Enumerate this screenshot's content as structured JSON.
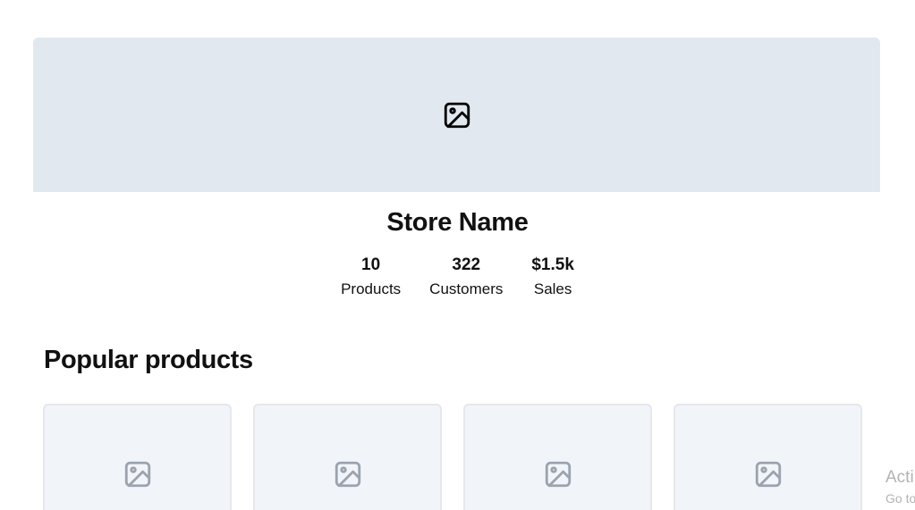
{
  "store": {
    "banner_icon": "image-placeholder-icon",
    "name": "Store Name"
  },
  "stats": [
    {
      "value": "10",
      "label": "Products"
    },
    {
      "value": "322",
      "label": "Customers"
    },
    {
      "value": "$1.5k",
      "label": "Sales"
    }
  ],
  "popular": {
    "title": "Popular products",
    "products": [
      {
        "icon": "image-placeholder-icon"
      },
      {
        "icon": "image-placeholder-icon"
      },
      {
        "icon": "image-placeholder-icon"
      },
      {
        "icon": "image-placeholder-icon"
      }
    ]
  },
  "watermark": {
    "line1": "Acti",
    "line2": "Go to"
  },
  "colors": {
    "banner_bg": "#e2e8f0",
    "card_bg": "#f1f5f9",
    "card_border": "#e5e7eb",
    "placeholder_icon": "#9ca3af",
    "text": "#111111"
  }
}
